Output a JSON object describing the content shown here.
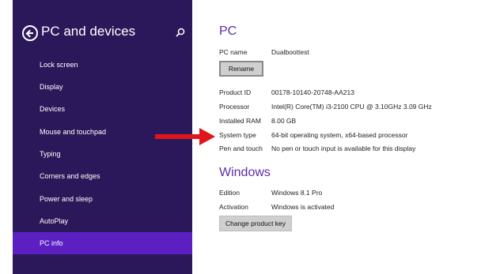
{
  "sidebar": {
    "title": "PC and devices",
    "items": [
      {
        "label": "Lock screen"
      },
      {
        "label": "Display"
      },
      {
        "label": "Devices"
      },
      {
        "label": "Mouse and touchpad"
      },
      {
        "label": "Typing"
      },
      {
        "label": "Corners and edges"
      },
      {
        "label": "Power and sleep"
      },
      {
        "label": "AutoPlay"
      },
      {
        "label": "PC info"
      }
    ],
    "selected": "PC info"
  },
  "pc": {
    "heading": "PC",
    "name_label": "PC name",
    "name_value": "Dualboottest",
    "rename_button": "Rename",
    "rows": [
      {
        "label": "Product ID",
        "value": "00178-10140-20748-AA213"
      },
      {
        "label": "Processor",
        "value": "Intel(R) Core(TM) i3-2100 CPU @ 3.10GHz   3.09 GHz"
      },
      {
        "label": "Installed RAM",
        "value": "8.00 GB"
      },
      {
        "label": "System type",
        "value": "64-bit operating system, x64-based processor"
      },
      {
        "label": "Pen and touch",
        "value": "No pen or touch input is available for this display"
      }
    ]
  },
  "windows": {
    "heading": "Windows",
    "rows": [
      {
        "label": "Edition",
        "value": "Windows 8.1 Pro"
      },
      {
        "label": "Activation",
        "value": "Windows is activated"
      }
    ],
    "change_key_button": "Change product key"
  },
  "colors": {
    "sidebar_bg": "#2b185a",
    "selected_bg": "#5b1fc2",
    "heading": "#5a2fa8",
    "arrow": "#e0161c"
  }
}
